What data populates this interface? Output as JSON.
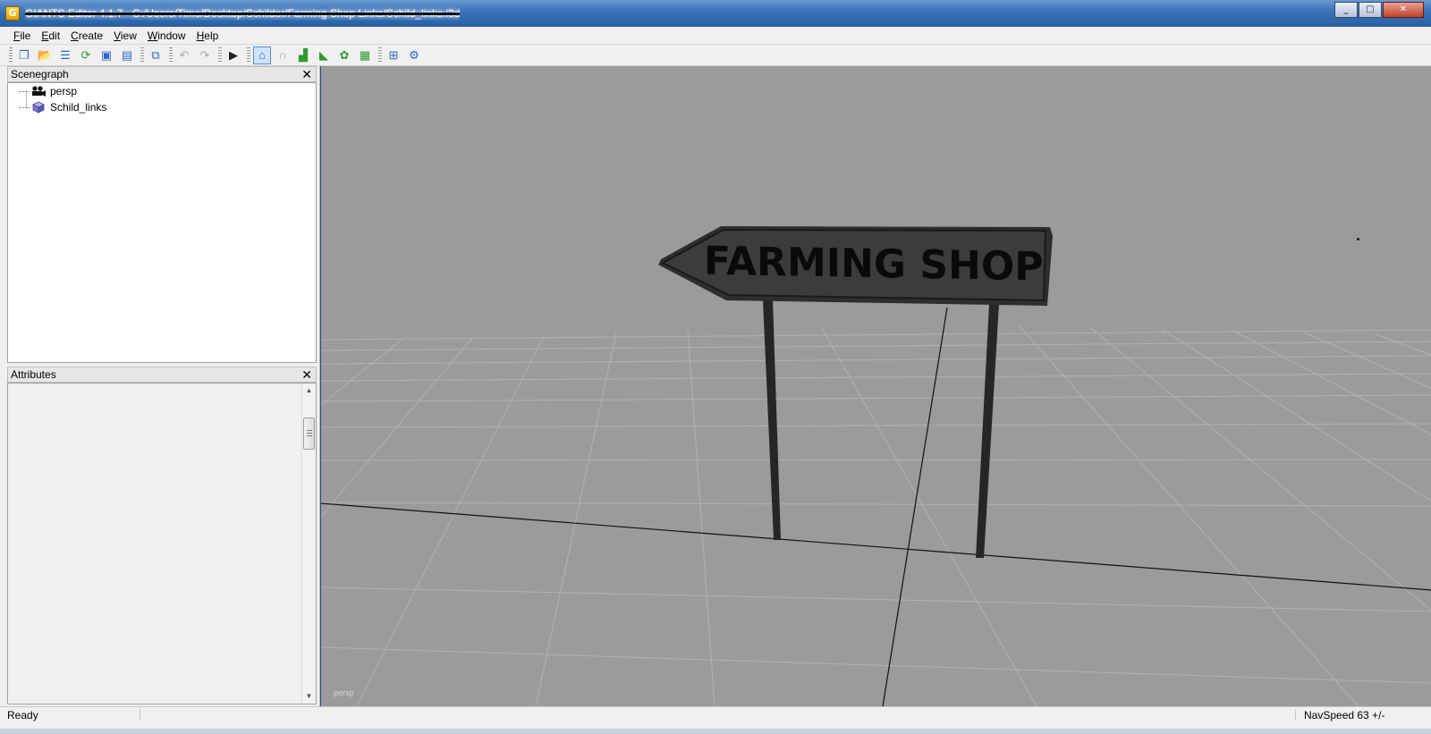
{
  "window": {
    "title": "GIANTS Editor 4.1.7 - C:/Users/Timo/Desktop/Schilder/Farming Shop Links/Schild_links.i3d",
    "minimize_glyph": "_",
    "maximize_glyph": "□",
    "close_glyph": "✕"
  },
  "menu": {
    "items": [
      {
        "label": "File",
        "underline": "F",
        "rest": "ile"
      },
      {
        "label": "Edit",
        "underline": "E",
        "rest": "dit"
      },
      {
        "label": "Create",
        "underline": "C",
        "rest": "reate"
      },
      {
        "label": "View",
        "underline": "V",
        "rest": "iew"
      },
      {
        "label": "Window",
        "underline": "W",
        "rest": "indow"
      },
      {
        "label": "Help",
        "underline": "H",
        "rest": "elp"
      }
    ]
  },
  "toolbar": {
    "icons": [
      "new-file-icon",
      "open-file-icon",
      "properties-icon",
      "reload-icon",
      "save-icon",
      "save-as-icon",
      "import-icon",
      "undo-icon",
      "redo-icon",
      "play-icon",
      "select-tool-icon",
      "move-tool-icon",
      "terrain-sculpt-icon",
      "terrain-paint-icon",
      "foliage-paint-icon",
      "height-icon",
      "checker-icon",
      "camera-settings-icon"
    ]
  },
  "scenegraph": {
    "title": "Scenegraph",
    "close_glyph": "✕",
    "nodes": [
      {
        "label": "persp",
        "icon": "camera-icon"
      },
      {
        "label": "Schild_links",
        "icon": "shape-cube-icon"
      }
    ]
  },
  "attributes": {
    "title": "Attributes",
    "close_glyph": "✕"
  },
  "viewport": {
    "camera_label": "persp",
    "sign_text": "FARMING SHOP"
  },
  "statusbar": {
    "status": "Ready",
    "navspeed": "NavSpeed 63 +/-"
  },
  "colors": {
    "viewport_bg": "#9b9b9b",
    "grid_line": "#b2b2b2",
    "sign_face": "#3c3c3c",
    "sign_text": "#0a0a0a"
  }
}
